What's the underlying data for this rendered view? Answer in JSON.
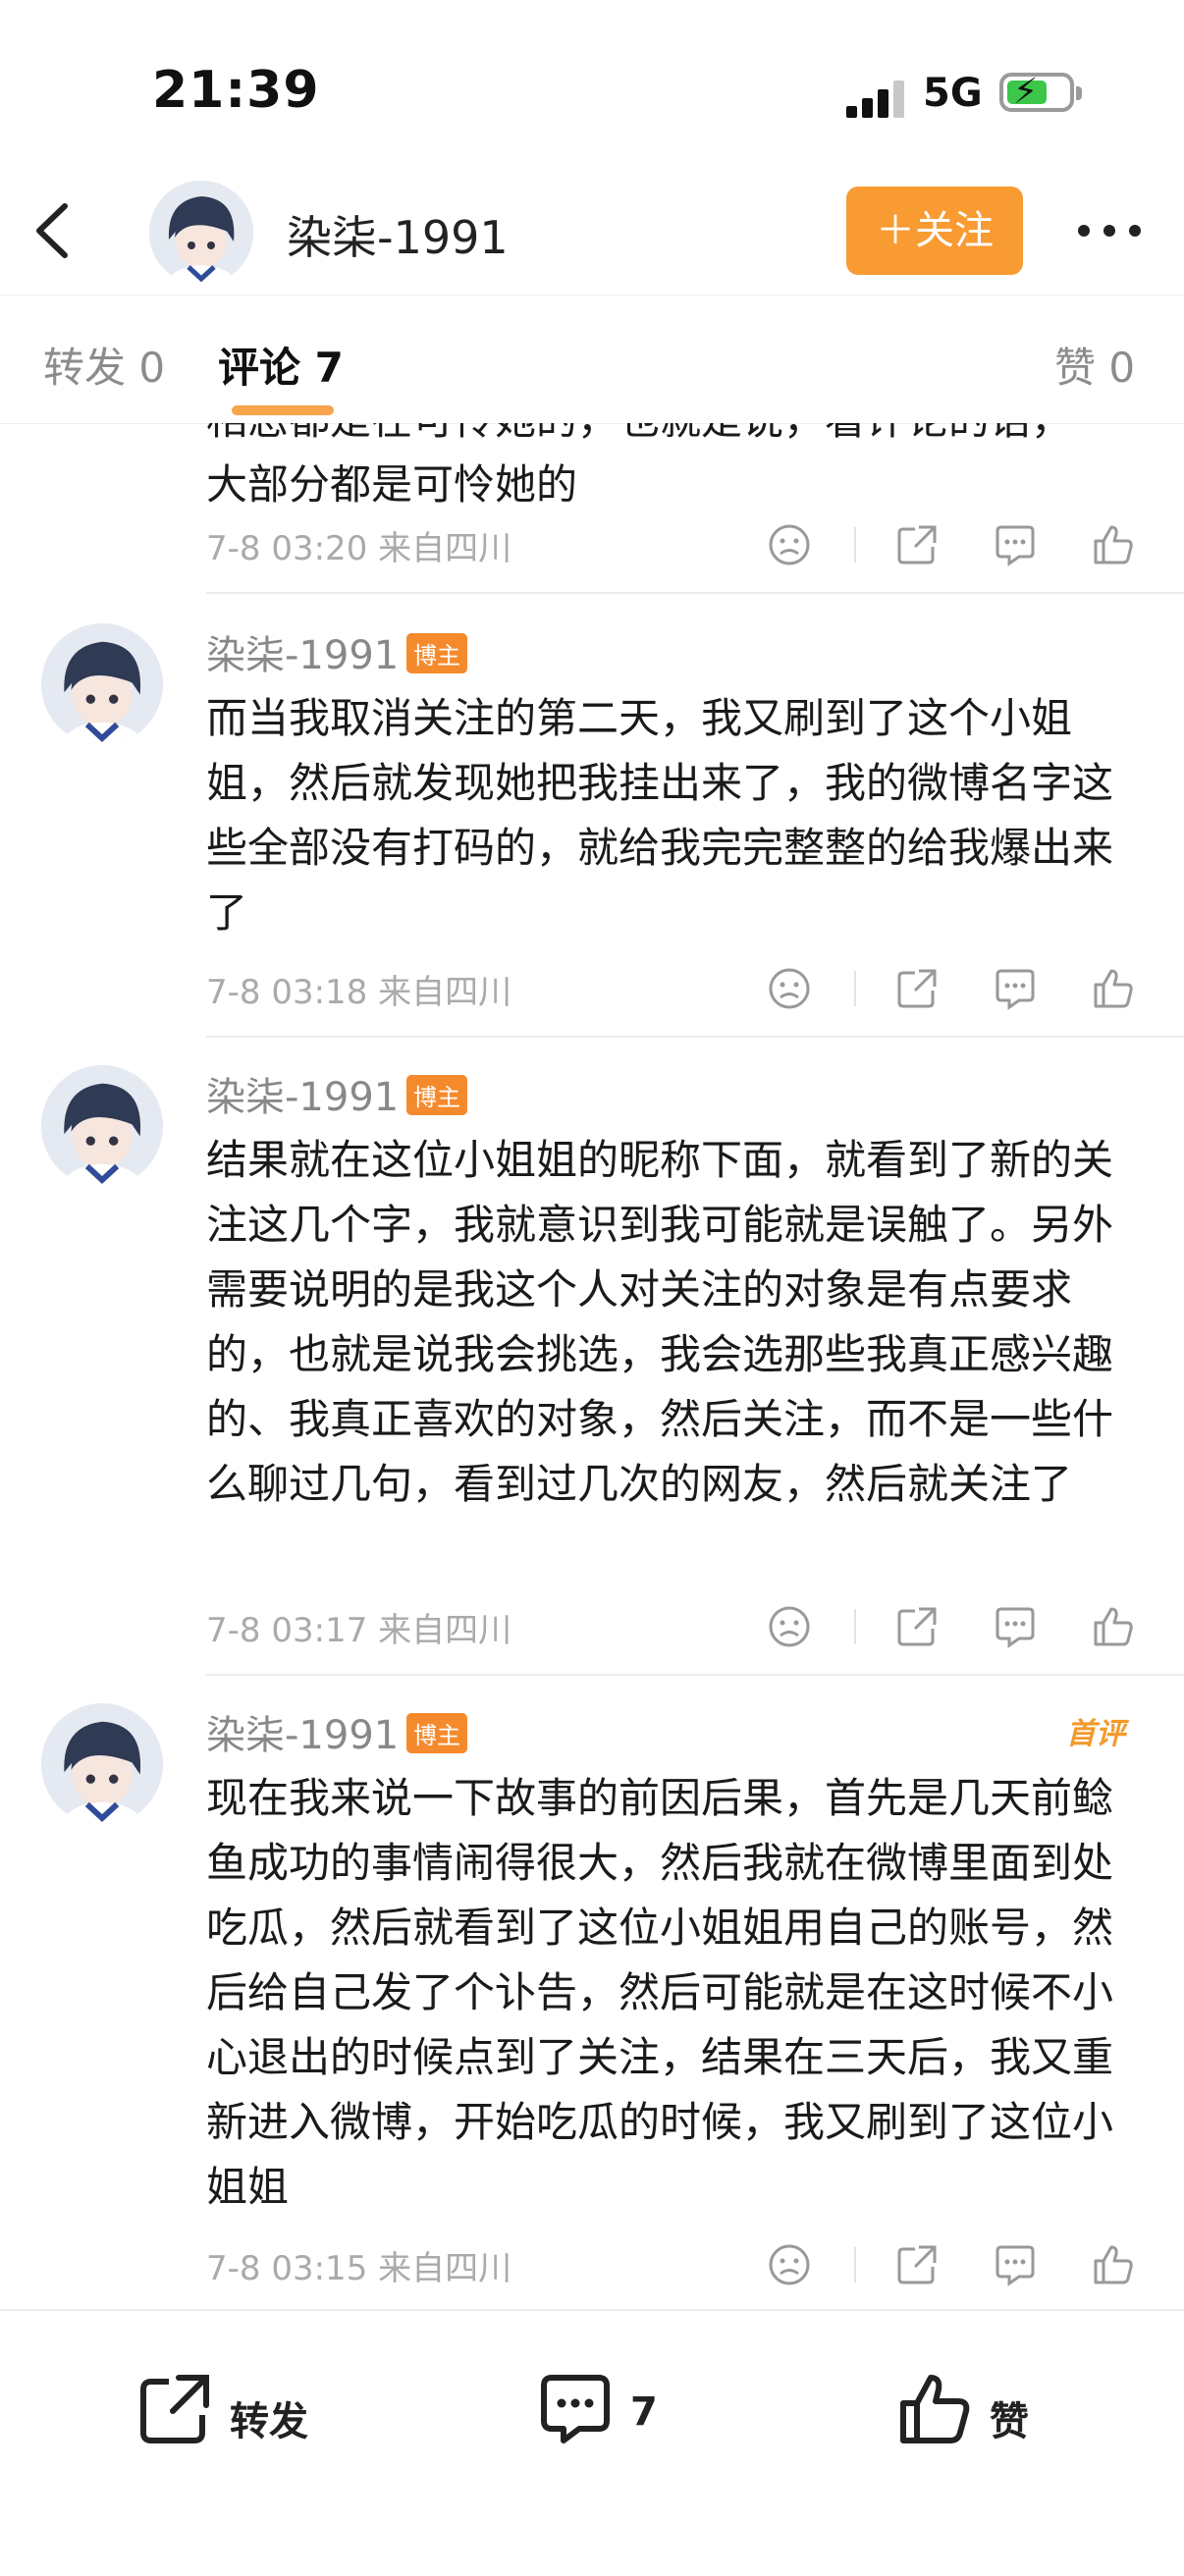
{
  "status_bar": {
    "time": "21:39",
    "network": "5G"
  },
  "header": {
    "username": "染柒-1991",
    "follow_label": "＋关注"
  },
  "tabs": [
    {
      "label": "转发 0"
    },
    {
      "label": "评论 7",
      "active": true
    },
    {
      "label": "赞 0"
    }
  ],
  "comments": [
    {
      "partial_line_1": "相恋都是在可怜她的，也就是说，看评论的话，",
      "partial_line_2": "大部分都是可怜她的",
      "time": "7-8 03:20",
      "location": "来自四川"
    },
    {
      "username": "染柒-1991",
      "badge": "博主",
      "text": "而当我取消关注的第二天，我又刷到了这个小姐姐，然后就发现她把我挂出来了，我的微博名字这些全部没有打码的，就给我完完整整的给我爆出来了",
      "time": "7-8 03:18",
      "location": "来自四川"
    },
    {
      "username": "染柒-1991",
      "badge": "博主",
      "text": "结果就在这位小姐姐的昵称下面，就看到了新的关注这几个字，我就意识到我可能就是误触了。另外需要说明的是我这个人对关注的对象是有点要求的，也就是说我会挑选，我会选那些我真正感兴趣的、我真正喜欢的对象，然后关注，而不是一些什么聊过几句，看到过几次的网友，然后就关注了",
      "time": "7-8 03:17",
      "location": "来自四川"
    },
    {
      "username": "染柒-1991",
      "badge": "博主",
      "tag": "首评",
      "text": "现在我来说一下故事的前因后果，首先是几天前鲶鱼成功的事情闹得很大，然后我就在微博里面到处吃瓜，然后就看到了这位小姐姐用自己的账号，然后给自己发了个讣告，然后可能就是在这时候不小心退出的时候点到了关注，结果在三天后，我又重新进入微博，开始吃瓜的时候，我又刷到了这位小姐姐",
      "time": "7-8 03:15",
      "location": "来自四川"
    }
  ],
  "bottom_bar": {
    "repost_label": "转发",
    "comment_count": "7",
    "like_label": "赞"
  },
  "colors": {
    "accent": "#f89b33",
    "badge": "#f58a2c",
    "meta": "#aaaaaa"
  }
}
